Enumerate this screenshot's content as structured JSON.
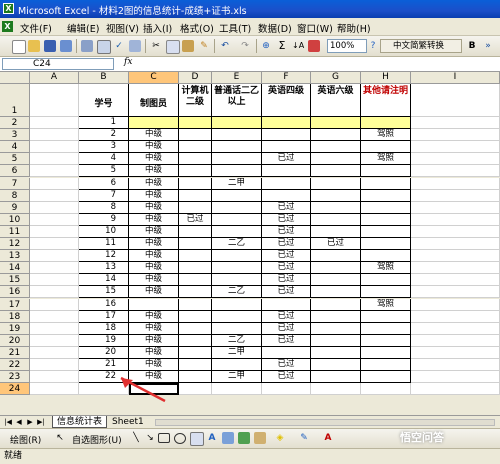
{
  "window": {
    "title": "Microsoft Excel - 材料2图的信息统计-成绩+证书.xls"
  },
  "menu": [
    "文件(F)",
    "编辑(E)",
    "视图(V)",
    "插入(I)",
    "格式(O)",
    "工具(T)",
    "数据(D)",
    "窗口(W)",
    "帮助(H)"
  ],
  "toolbar": {
    "zoom": "100%",
    "font_tool": "中文简繁转换"
  },
  "formula_bar": {
    "name_box": "C24",
    "fx": "fx",
    "content": ""
  },
  "columns": [
    "A",
    "B",
    "C",
    "D",
    "E",
    "F",
    "G",
    "H",
    "I"
  ],
  "header_row": {
    "B": "学号",
    "C": "制图员",
    "D": "计算机二级",
    "E": "普通话二乙以上",
    "F": "英语四级",
    "G": "英语六级",
    "H": "其他请注明"
  },
  "rows": [
    {
      "n": "1",
      "B": "",
      "C": "",
      "D": "",
      "E": "",
      "F": "",
      "G": "",
      "H": ""
    },
    {
      "n": "2",
      "B": "1",
      "C": "",
      "D": "",
      "E": "",
      "F": "",
      "G": "",
      "H": ""
    },
    {
      "n": "3",
      "B": "2",
      "C": "中级",
      "D": "",
      "E": "",
      "F": "",
      "G": "",
      "H": "驾照"
    },
    {
      "n": "4",
      "B": "3",
      "C": "中级",
      "D": "",
      "E": "",
      "F": "",
      "G": "",
      "H": ""
    },
    {
      "n": "5",
      "B": "4",
      "C": "中级",
      "D": "",
      "E": "",
      "F": "已过",
      "G": "",
      "H": "驾照"
    },
    {
      "n": "6",
      "B": "5",
      "C": "中级",
      "D": "",
      "E": "",
      "F": "",
      "G": "",
      "H": ""
    },
    {
      "n": "7",
      "B": "6",
      "C": "中级",
      "D": "",
      "E": "二甲",
      "F": "",
      "G": "",
      "H": ""
    },
    {
      "n": "8",
      "B": "7",
      "C": "中级",
      "D": "",
      "E": "",
      "F": "",
      "G": "",
      "H": ""
    },
    {
      "n": "9",
      "B": "8",
      "C": "中级",
      "D": "",
      "E": "",
      "F": "已过",
      "G": "",
      "H": ""
    },
    {
      "n": "10",
      "B": "9",
      "C": "中级",
      "D": "已过",
      "E": "",
      "F": "已过",
      "G": "",
      "H": ""
    },
    {
      "n": "11",
      "B": "10",
      "C": "中级",
      "D": "",
      "E": "",
      "F": "已过",
      "G": "",
      "H": ""
    },
    {
      "n": "12",
      "B": "11",
      "C": "中级",
      "D": "",
      "E": "二乙",
      "F": "已过",
      "G": "已过",
      "H": ""
    },
    {
      "n": "13",
      "B": "12",
      "C": "中级",
      "D": "",
      "E": "",
      "F": "已过",
      "G": "",
      "H": ""
    },
    {
      "n": "14",
      "B": "13",
      "C": "中级",
      "D": "",
      "E": "",
      "F": "已过",
      "G": "",
      "H": "驾照"
    },
    {
      "n": "15",
      "B": "14",
      "C": "中级",
      "D": "",
      "E": "",
      "F": "已过",
      "G": "",
      "H": ""
    },
    {
      "n": "16",
      "B": "15",
      "C": "中级",
      "D": "",
      "E": "二乙",
      "F": "已过",
      "G": "",
      "H": ""
    },
    {
      "n": "17",
      "B": "16",
      "C": "",
      "D": "",
      "E": "",
      "F": "",
      "G": "",
      "H": "驾照"
    },
    {
      "n": "18",
      "B": "17",
      "C": "中级",
      "D": "",
      "E": "",
      "F": "已过",
      "G": "",
      "H": ""
    },
    {
      "n": "19",
      "B": "18",
      "C": "中级",
      "D": "",
      "E": "",
      "F": "已过",
      "G": "",
      "H": ""
    },
    {
      "n": "20",
      "B": "19",
      "C": "中级",
      "D": "",
      "E": "二乙",
      "F": "已过",
      "G": "",
      "H": ""
    },
    {
      "n": "21",
      "B": "20",
      "C": "中级",
      "D": "",
      "E": "二甲",
      "F": "",
      "G": "",
      "H": ""
    },
    {
      "n": "22",
      "B": "21",
      "C": "中级",
      "D": "",
      "E": "",
      "F": "已过",
      "G": "",
      "H": ""
    },
    {
      "n": "23",
      "B": "22",
      "C": "中级",
      "D": "",
      "E": "二甲",
      "F": "已过",
      "G": "",
      "H": ""
    },
    {
      "n": "24",
      "B": "",
      "C": "",
      "D": "",
      "E": "",
      "F": "",
      "G": "",
      "H": ""
    }
  ],
  "sheet_tabs": [
    "信息统计表",
    "Sheet1"
  ],
  "drawing_toolbar": {
    "draw_label": "绘图(R)",
    "autoshapes_label": "自选图形(U)"
  },
  "status": "就绪",
  "watermark": "悟空问答",
  "colors": {
    "title_blue": "#0a4fc9",
    "header_yellow": "#ffff99",
    "selected_header": "#ffc67a",
    "red_text": "#c00000",
    "arrow_red": "#e03030"
  }
}
